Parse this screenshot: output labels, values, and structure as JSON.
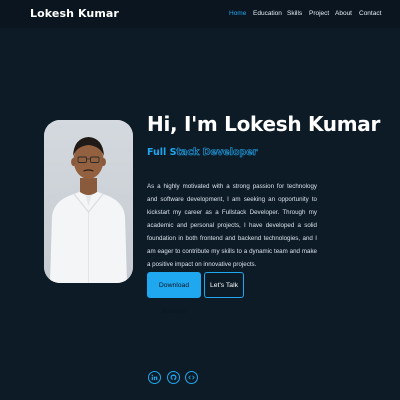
{
  "navbar": {
    "brand": "Lokesh Kumar",
    "links": [
      {
        "label": "Home",
        "active": true
      },
      {
        "label": "Education",
        "active": false
      },
      {
        "label": "Skills",
        "active": false
      },
      {
        "label": "Project",
        "active": false
      },
      {
        "label": "About",
        "active": false
      },
      {
        "label": "Contact",
        "active": false
      }
    ]
  },
  "hero": {
    "title": "Hi, I'm Lokesh Kumar",
    "subtitle_solid": "Full S",
    "subtitle_outline": "tack Developer",
    "description": "As a highly motivated with a strong passion for technology and software development, I am seeking an opportunity to kickstart my career as a Fullstack Developer. Through my academic and personal projects, I have developed a solid foundation in both frontend and backend technologies, and I am eager to contribute my skills to a dynamic team and make a positive impact on innovative projects.",
    "primary_button": "Download Resume",
    "secondary_button": "Let's Talk"
  },
  "social": {
    "icons": [
      "linkedin-icon",
      "github-icon",
      "code-icon"
    ]
  },
  "colors": {
    "background": "#0d1b27",
    "accent": "#1fa7ef",
    "text": "#ffffff"
  }
}
